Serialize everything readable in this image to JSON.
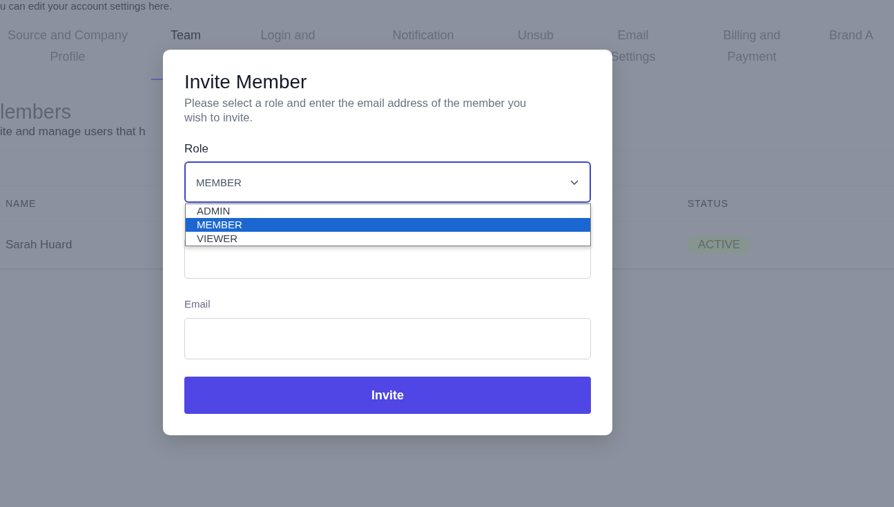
{
  "page": {
    "intro": "u can edit your account settings here.",
    "tabs": [
      {
        "label": "Source and Company Profile",
        "selected": false
      },
      {
        "label": "Team",
        "selected": true
      },
      {
        "label": "Login and",
        "selected": false
      },
      {
        "label": "Notification",
        "selected": false
      },
      {
        "label": "Unsub",
        "selected": false
      },
      {
        "label": "Email Settings",
        "selected": false
      },
      {
        "label": "Billing and Payment",
        "selected": false
      },
      {
        "label": "Brand A",
        "selected": false
      }
    ],
    "section": {
      "title": "lembers",
      "subtitle": "ite and manage users that h"
    },
    "table": {
      "columns": [
        "NAME",
        "STATUS"
      ],
      "rows": [
        {
          "name": "Sarah Huard",
          "status": "ACTIVE"
        }
      ]
    }
  },
  "modal": {
    "title": "Invite Member",
    "description": "Please select a role and enter the email address of the member you wish to invite.",
    "role": {
      "label": "Role",
      "value": "MEMBER",
      "expanded": true,
      "options": [
        {
          "label": "ADMIN",
          "selected": false
        },
        {
          "label": "MEMBER",
          "selected": true
        },
        {
          "label": "VIEWER",
          "selected": false
        }
      ]
    },
    "email": {
      "label": "Email"
    },
    "button": "Invite"
  }
}
